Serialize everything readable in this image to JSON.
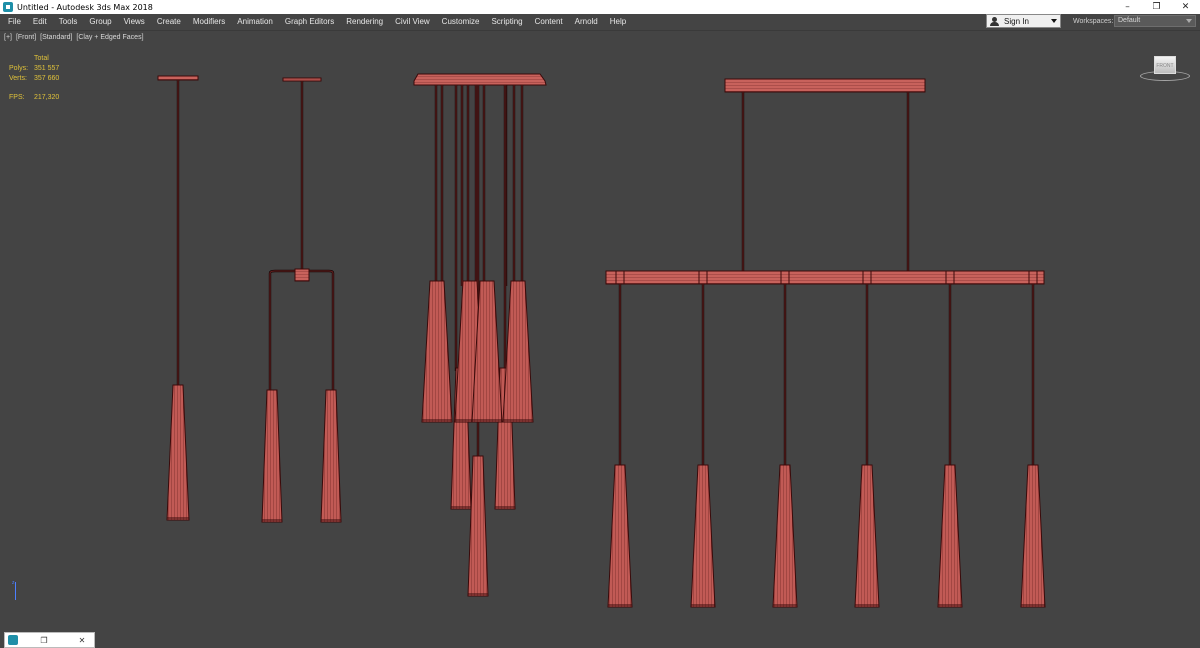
{
  "window": {
    "title": "Untitled - Autodesk 3ds Max 2018",
    "minimize_glyph": "–",
    "restore_glyph": "❐",
    "close_glyph": "✕"
  },
  "menu": {
    "items": [
      "File",
      "Edit",
      "Tools",
      "Group",
      "Views",
      "Create",
      "Modifiers",
      "Animation",
      "Graph Editors",
      "Rendering",
      "Civil View",
      "Customize",
      "Scripting",
      "Content",
      "Arnold",
      "Help"
    ]
  },
  "account": {
    "sign_in_label": "Sign In",
    "workspaces_label": "Workspaces:",
    "workspace_value": "Default"
  },
  "viewport": {
    "menu_plus": "[+]",
    "view_label": "[Front]",
    "shading_quality": "[Standard]",
    "shading_mode": "[Clay + Edged Faces]",
    "stats": {
      "header": "Total",
      "polys_label": "Polys:",
      "polys_value": "351 557",
      "verts_label": "Verts:",
      "verts_value": "357 660",
      "fps_label": "FPS:",
      "fps_value": "217,320"
    },
    "viewcube_label": "FRONT",
    "axis_label": "z"
  },
  "mini_panel": {
    "restore_glyph": "❐",
    "close_glyph": "✕"
  },
  "colors": {
    "background": "#444444",
    "wire_fill": "#c15a55",
    "wire_edge": "#3a0a0a",
    "stats_text": "#e0c23a"
  }
}
